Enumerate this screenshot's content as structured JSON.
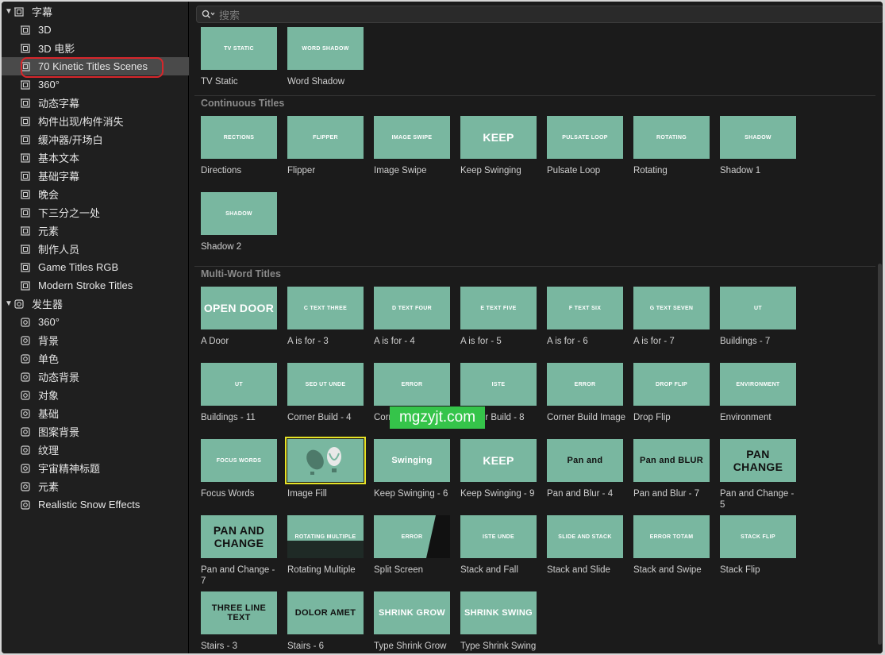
{
  "sidebar": {
    "groups": [
      {
        "label": "字幕",
        "icon": "titles-icon",
        "children": [
          "3D",
          "3D 电影",
          "70 Kinetic Titles Scenes",
          "360°",
          "动态字幕",
          "构件出现/构件消失",
          "缓冲器/开场白",
          "基本文本",
          "基础字幕",
          "晚会",
          "下三分之一处",
          "元素",
          "制作人员",
          "Game Titles RGB",
          "Modern Stroke Titles"
        ]
      },
      {
        "label": "发生器",
        "icon": "generators-icon",
        "children": [
          "360°",
          "背景",
          "单色",
          "动态背景",
          "对象",
          "基础",
          "图案背景",
          "纹理",
          "宇宙精神标题",
          "元素",
          "Realistic Snow Effects"
        ]
      }
    ],
    "selected": "70 Kinetic Titles Scenes"
  },
  "search": {
    "placeholder": "搜索"
  },
  "sections": [
    {
      "title": "",
      "tiles": [
        {
          "label": "TV Static",
          "thumb": "TV STATIC"
        },
        {
          "label": "Word Shadow",
          "thumb": "WORD SHADOW"
        }
      ]
    },
    {
      "title": "Continuous Titles",
      "tiles": [
        {
          "label": "Directions",
          "thumb": "RECTIONS"
        },
        {
          "label": "Flipper",
          "thumb": "FLIPPER"
        },
        {
          "label": "Image Swipe",
          "thumb": "IMAGE SWIPE"
        },
        {
          "label": "Keep Swinging",
          "thumb": "KEEP"
        },
        {
          "label": "Pulsate Loop",
          "thumb": "PULSATE LOOP"
        },
        {
          "label": "Rotating",
          "thumb": "ROTATING"
        },
        {
          "label": "Shadow 1",
          "thumb": "SHADOW"
        },
        {
          "label": "Shadow 2",
          "thumb": "SHADOW"
        }
      ]
    },
    {
      "title": "Multi-Word Titles",
      "tiles": [
        {
          "label": "A Door",
          "thumb": "OPEN DOOR"
        },
        {
          "label": "A is for - 3",
          "thumb": "C TEXT THREE"
        },
        {
          "label": "A is for - 4",
          "thumb": "D TEXT FOUR"
        },
        {
          "label": "A is for - 5",
          "thumb": "E TEXT FIVE"
        },
        {
          "label": "A is for - 6",
          "thumb": "F TEXT SIX"
        },
        {
          "label": "A is for - 7",
          "thumb": "G TEXT SEVEN"
        },
        {
          "label": "Buildings - 7",
          "thumb": "UT"
        },
        {
          "label": "Buildings - 11",
          "thumb": "UT"
        },
        {
          "label": "Corner Build - 4",
          "thumb": "SED UT UNDE"
        },
        {
          "label": "Corner Build - 6",
          "thumb": "ERROR"
        },
        {
          "label": "Corner Build - 8",
          "thumb": "ISTE"
        },
        {
          "label": "Corner Build Image",
          "thumb": "ERROR"
        },
        {
          "label": "Drop Flip",
          "thumb": "DROP FLIP"
        },
        {
          "label": "Environment",
          "thumb": "ENVIRONMENT"
        },
        {
          "label": "Focus Words",
          "thumb": "FOCUS WORDS"
        },
        {
          "label": "Image Fill",
          "thumb": ""
        },
        {
          "label": "Keep Swinging - 6",
          "thumb": "Swinging"
        },
        {
          "label": "Keep Swinging - 9",
          "thumb": "KEEP"
        },
        {
          "label": "Pan and Blur - 4",
          "thumb": "Pan and"
        },
        {
          "label": "Pan and Blur - 7",
          "thumb": "Pan and BLUR"
        },
        {
          "label": "Pan and Change - 5",
          "thumb": "PAN CHANGE"
        },
        {
          "label": "Pan and Change - 7",
          "thumb": "PAN AND CHANGE"
        },
        {
          "label": "Rotating Multiple",
          "thumb": "ROTATING MULTIPLE"
        },
        {
          "label": "Split Screen",
          "thumb": "ERROR"
        },
        {
          "label": "Stack and Fall",
          "thumb": "ISTE UNDE"
        },
        {
          "label": "Stack and Slide",
          "thumb": "SLIDE AND STACK"
        },
        {
          "label": "Stack and Swipe",
          "thumb": "ERROR TOTAM"
        },
        {
          "label": "Stack Flip",
          "thumb": "STACK FLIP"
        },
        {
          "label": "Stairs - 3",
          "thumb": "THREE LINE TEXT"
        },
        {
          "label": "Stairs - 6",
          "thumb": "DOLOR AMET"
        },
        {
          "label": "Type Shrink Grow",
          "thumb": "SHRINK GROW"
        },
        {
          "label": "Type Shrink Swing",
          "thumb": "SHRINK SWING"
        }
      ]
    }
  ],
  "selected_tile": "Image Fill",
  "watermark": "mgzyjt.com",
  "colors": {
    "thumb": "#79b7a0",
    "selection": "#e5e226",
    "ring": "#d7262b",
    "watermark": "#35c44a"
  }
}
